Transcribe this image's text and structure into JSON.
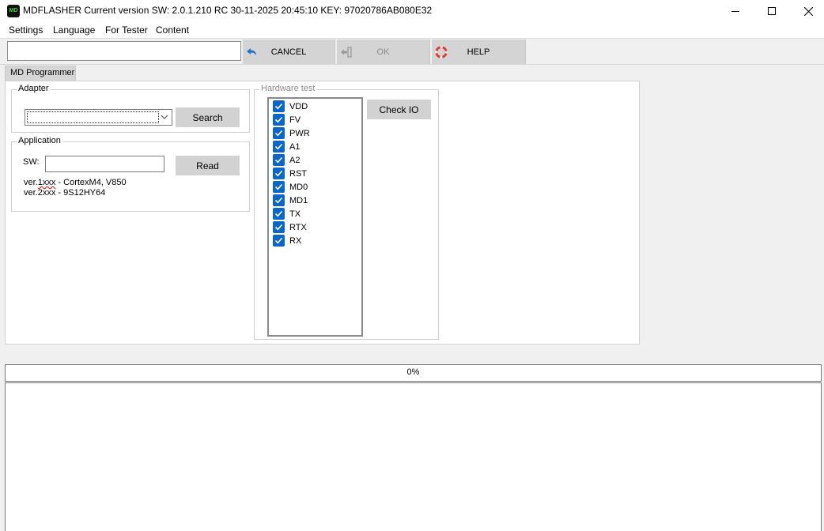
{
  "window": {
    "logo_text": "MD",
    "title": "MDFLASHER  Current version SW: 2.0.1.210 RC 30-11-2025 20:45:10  KEY: 97020786AB080E32"
  },
  "menu": [
    "Settings",
    "Language",
    "For Tester",
    "Content"
  ],
  "toolbar": {
    "input_value": "",
    "cancel_label": "CANCEL",
    "ok_label": "OK",
    "help_label": "HELP",
    "icons": {
      "cancel": "undo-arrow-icon",
      "ok": "login-arrow-icon",
      "help": "lifebuoy-icon"
    }
  },
  "tab": {
    "label": "MD Programmer"
  },
  "adapter": {
    "legend": "Adapter",
    "selected": "",
    "search_label": "Search"
  },
  "application": {
    "legend": "Application",
    "sw_label": "SW:",
    "sw_value": "",
    "read_label": "Read",
    "ver1_prefix": "ver.",
    "ver1_code": "1xxx",
    "ver1_desc": " - CortexM4, V850",
    "ver2": "ver.2xxx - 9S12HY64"
  },
  "hardware_test": {
    "legend": "Hardware test",
    "check_io_label": "Check IO",
    "items": [
      {
        "label": "VDD",
        "checked": true
      },
      {
        "label": "FV",
        "checked": true
      },
      {
        "label": "PWR",
        "checked": true
      },
      {
        "label": "A1",
        "checked": true
      },
      {
        "label": "A2",
        "checked": true
      },
      {
        "label": "RST",
        "checked": true
      },
      {
        "label": "MD0",
        "checked": true
      },
      {
        "label": "MD1",
        "checked": true
      },
      {
        "label": "TX",
        "checked": true
      },
      {
        "label": "RTX",
        "checked": true
      },
      {
        "label": "RX",
        "checked": true
      }
    ]
  },
  "progress": {
    "value": 0,
    "text": "0%"
  },
  "log": {
    "content": ""
  },
  "colors": {
    "checkbox": "#0a66c8",
    "button": "#d2d2d2",
    "cancel_icon": "#1a73c9",
    "help_icon": "#e03a2f",
    "spellcheck_underline": "#e02020"
  }
}
